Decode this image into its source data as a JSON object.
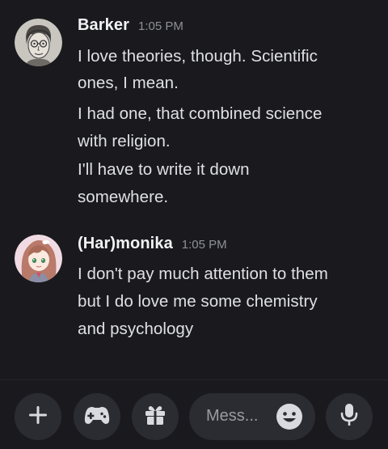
{
  "messages": [
    {
      "username": "Barker",
      "time": "1:05 PM",
      "avatar_icon": "sketch-portrait-avatar",
      "lines": [
        "I love theories, though. Scientific",
        "ones, I mean.",
        "I had one, that combined science",
        "with religion.",
        "I'll have to write it down",
        "somewhere."
      ]
    },
    {
      "username": "(Har)monika",
      "time": "1:05 PM",
      "avatar_icon": "anime-girl-avatar",
      "lines": [
        "I don't pay much attention to them",
        "but I do love me some chemistry",
        "and psychology"
      ]
    }
  ],
  "composer": {
    "placeholder": "Mess...",
    "buttons": [
      "plus-icon",
      "gamepad-icon",
      "gift-icon",
      "emoji-icon",
      "microphone-icon"
    ]
  },
  "colors": {
    "background": "#1a1a1e",
    "button_bg": "#2b2c31",
    "text": "#dfe0e4",
    "username": "#f2f3f5",
    "timestamp": "#8e9096"
  }
}
